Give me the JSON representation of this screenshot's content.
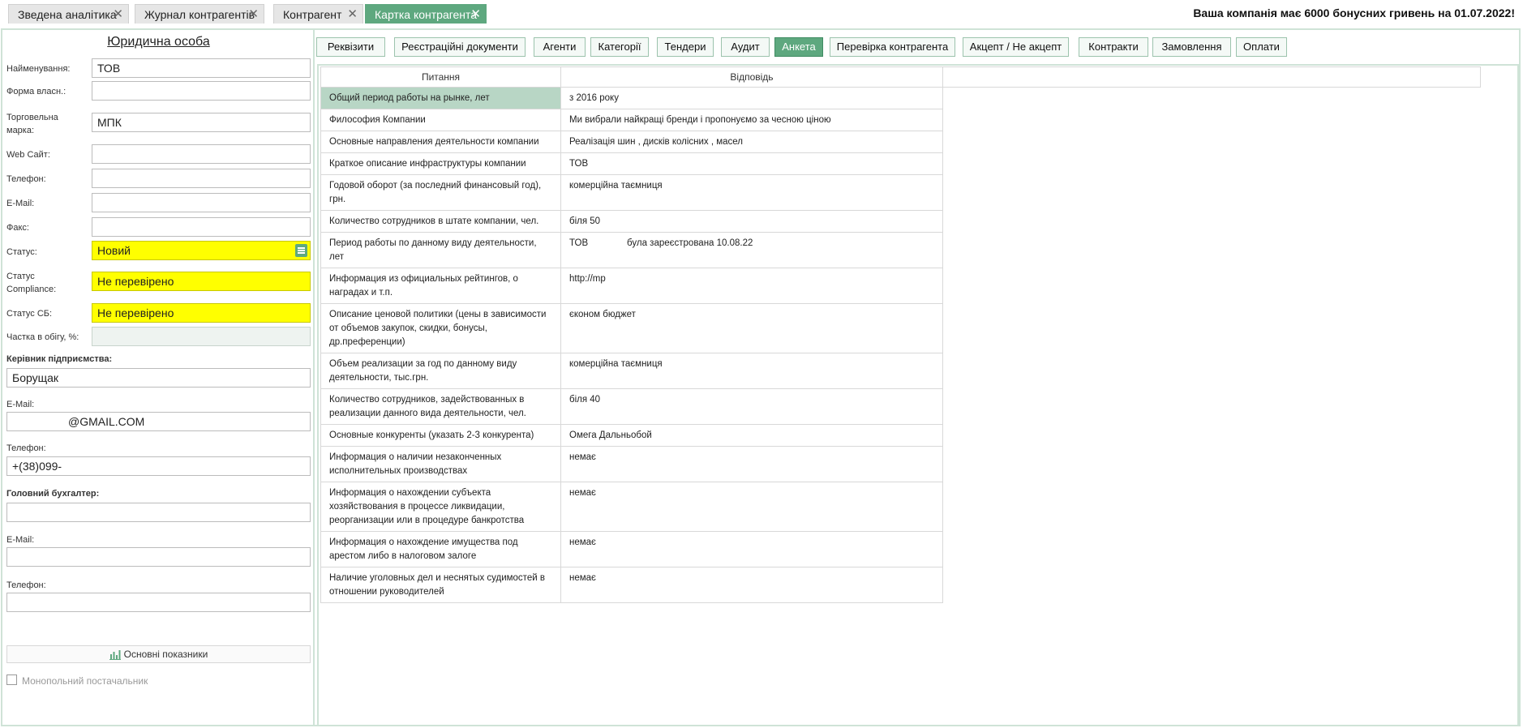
{
  "tabs": [
    {
      "label": "Зведена аналітика"
    },
    {
      "label": "Журнал контрагентів"
    },
    {
      "label": "Контрагент"
    },
    {
      "label": "Картка контрагента"
    }
  ],
  "bonus_text": "Ваша компанія має 6000 бонусних гривень на 01.07.2022!",
  "left": {
    "title": "Юридична особа",
    "fields": {
      "name_label": "Найменування:",
      "name_value": "ТОВ",
      "ownership_label": "Форма власн.:",
      "ownership_value": "",
      "brand_label": "Торговельна марка:",
      "brand_value": "МПК",
      "website_label": "Web Сайт:",
      "website_value": "",
      "phone_label": "Телефон:",
      "phone_value": "",
      "email_label": "E-Mail:",
      "email_value": "",
      "fax_label": "Факс:",
      "fax_value": "",
      "status_label": "Статус:",
      "status_value": "Новий",
      "compliance_label": "Статус Compliance:",
      "compliance_value": "Не перевірено",
      "sb_label": "Статус СБ:",
      "sb_value": "Не перевірено",
      "share_label": "Частка в обігу, %:",
      "share_value": ""
    },
    "director": {
      "title": "Керівник підприємства:",
      "name": "Борущак",
      "email_label": "E-Mail:",
      "email_value": "@GMAIL.COM",
      "phone_label": "Телефон:",
      "phone_value": "+(38)099-"
    },
    "accountant": {
      "title": "Головний бухгалтер:",
      "name": "",
      "email_label": "E-Mail:",
      "email_value": "",
      "phone_label": "Телефон:",
      "phone_value": ""
    },
    "stats_button": "Основні показники",
    "monopoly_label": "Монопольний постачальник"
  },
  "toolbar": [
    "Реквізити",
    "Реєстраційні документи",
    "Агенти",
    "Категорії",
    "Тендери",
    "Аудит",
    "Анкета",
    "Перевірка контрагента",
    "Акцепт / Не акцепт",
    "Контракти",
    "Замовлення",
    "Оплати"
  ],
  "active_tab": "Анкета",
  "accent_color": "#5ea87f",
  "questionnaire": {
    "col_question": "Питання",
    "col_answer": "Відповідь",
    "rows": [
      {
        "q": "Общий период работы на рынке, лет",
        "a": "з 2016 року"
      },
      {
        "q": "Философия Компании",
        "a": "Ми вибрали найкращі бренди і пропонуємо за чесною ціною"
      },
      {
        "q": "Основные направления деятельности компании",
        "a": "Реалізація шин , дисків колісних , масел"
      },
      {
        "q": "Краткое описание инфраструктуры компании",
        "a": "ТОВ"
      },
      {
        "q": "Годовой оборот (за последний финансовый год), грн.",
        "a": "комерційна таємниця"
      },
      {
        "q": "Количество сотрудников в штате компании, чел.",
        "a": "біля 50"
      },
      {
        "q": "Период работы по данному виду деятельности, лет",
        "a": "ТОВ               була зареєстрована 10.08.22"
      },
      {
        "q": "Информация из официальных рейтингов, о наградах и т.п.",
        "a": "http://mp"
      },
      {
        "q": "Описание ценовой политики (цены в зависимости от объемов закупок, скидки, бонусы, др.преференции)",
        "a": "єконом бюджет"
      },
      {
        "q": "Объем реализации за год по данному виду деятельности, тыс.грн.",
        "a": "комерційна таємниця"
      },
      {
        "q": "Количество сотрудников, задействованных в реализации данного вида деятельности, чел.",
        "a": "біля 40"
      },
      {
        "q": "Основные конкуренты (указать 2-3 конкурента)",
        "a": "Омега Дальньобой"
      },
      {
        "q": "Информация о наличии незаконченных исполнительных производствах",
        "a": "немає"
      },
      {
        "q": "Информация о нахождении субъекта хозяйствования в процессе ликвидации, реорганизации или в процедуре банкротства",
        "a": "немає"
      },
      {
        "q": "Информация о нахождение имущества под арестом либо в налоговом залоге",
        "a": "немає"
      },
      {
        "q": "Наличие уголовных дел и неснятых судимостей в отношении руководителей",
        "a": "немає"
      }
    ]
  }
}
